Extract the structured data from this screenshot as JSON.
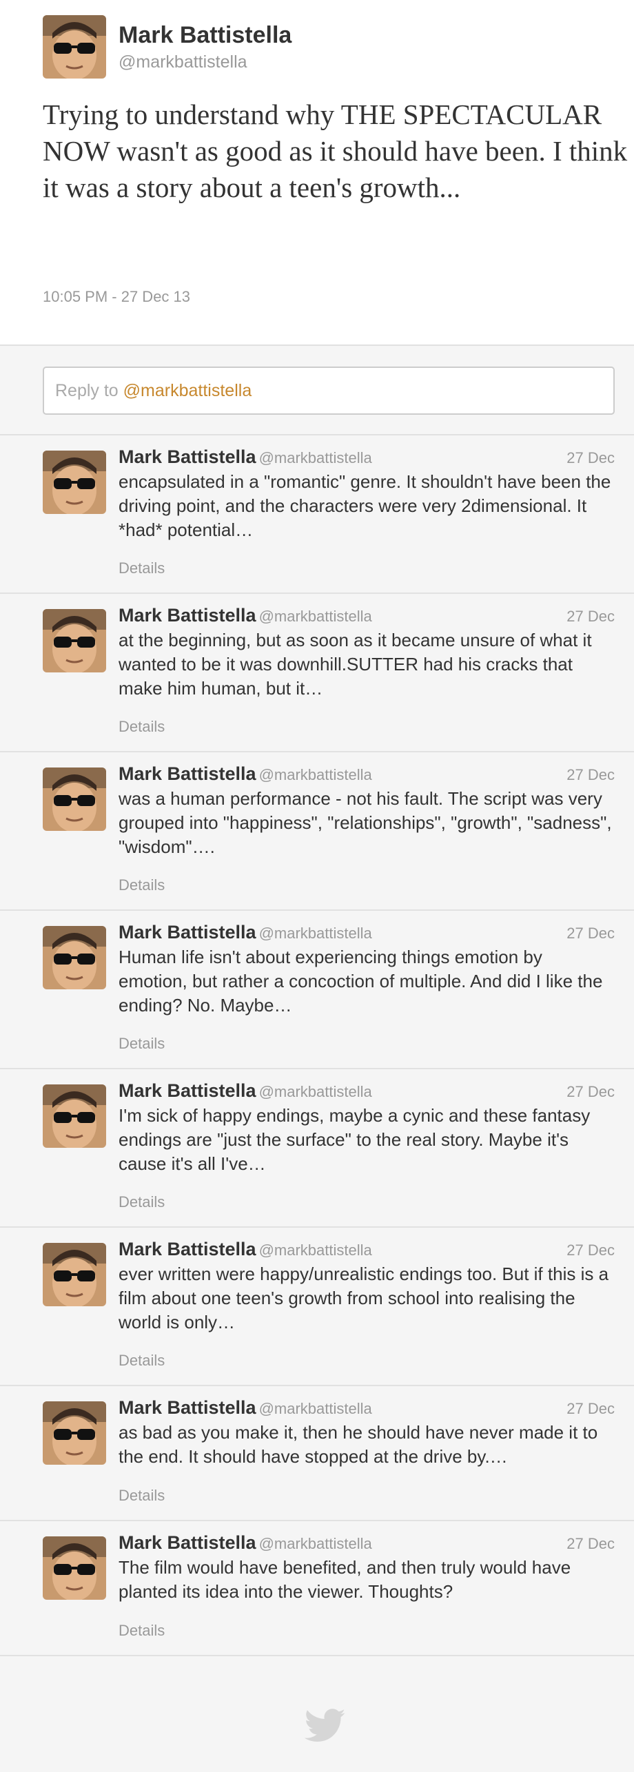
{
  "tweet": {
    "name": "Mark Battistella",
    "handle": "@markbattistella",
    "text": "Trying to understand why THE SPECTACULAR NOW wasn't as good as it should have been. I think it was a story about a teen's growth...",
    "timestamp": "10:05 PM - 27 Dec 13"
  },
  "reply_box": {
    "prefix": "Reply to",
    "mention": "@markbattistella"
  },
  "replies": [
    {
      "name": "Mark Battistella",
      "handle": "@markbattistella",
      "date": "27 Dec",
      "text": "encapsulated in a \"romantic\" genre. It shouldn't have been the driving point, and the characters were very 2dimensional. It *had* potential…",
      "details": "Details"
    },
    {
      "name": "Mark Battistella",
      "handle": "@markbattistella",
      "date": "27 Dec",
      "text": "at the beginning, but as soon as it became unsure of what it wanted to be it was downhill.SUTTER had his cracks that make him human, but it…",
      "details": "Details"
    },
    {
      "name": "Mark Battistella",
      "handle": "@markbattistella",
      "date": "27 Dec",
      "text": "was a human performance - not his fault. The script was very grouped into \"happiness\", \"relationships\", \"growth\", \"sadness\", \"wisdom\"….",
      "details": "Details"
    },
    {
      "name": "Mark Battistella",
      "handle": "@markbattistella",
      "date": "27 Dec",
      "text": "Human life isn't about experiencing things emotion by emotion, but rather a concoction of multiple. And did I like the ending? No. Maybe…",
      "details": "Details"
    },
    {
      "name": "Mark Battistella",
      "handle": "@markbattistella",
      "date": "27 Dec",
      "text": "I'm sick of happy endings, maybe a cynic and these fantasy endings are \"just the surface\" to the real story. Maybe it's cause it's all I've…",
      "details": "Details"
    },
    {
      "name": "Mark Battistella",
      "handle": "@markbattistella",
      "date": "27 Dec",
      "text": "ever written were happy/unrealistic endings too. But if this is a film about one teen's growth from school into realising the world is only…",
      "details": "Details"
    },
    {
      "name": "Mark Battistella",
      "handle": "@markbattistella",
      "date": "27 Dec",
      "text": "as bad as you make it, then he should have never made it to the end. It should have stopped at the drive by.…",
      "details": "Details"
    },
    {
      "name": "Mark Battistella",
      "handle": "@markbattistella",
      "date": "27 Dec",
      "text": "The film would have benefited, and then truly would have planted its idea into the viewer. Thoughts?",
      "details": "Details"
    }
  ],
  "footer": {
    "icon": "twitter-bird-icon"
  }
}
